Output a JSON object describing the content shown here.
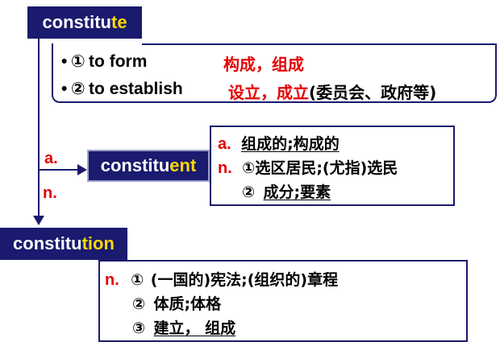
{
  "root_word": {
    "stem": "constitu",
    "suffix": "te"
  },
  "meanings": [
    {
      "num": "①",
      "en": "to form",
      "zh": "构成，组成",
      "zh_extra": ""
    },
    {
      "num": "②",
      "en": "to establish",
      "zh": "设立，成立",
      "zh_extra": "(委员会、政府等)"
    }
  ],
  "bullet": "•",
  "branch_labels": {
    "adjective": "a.",
    "noun": "n."
  },
  "derivative_1": {
    "stem": "constitu",
    "suffix": "ent",
    "def_a_label": "a.",
    "def_a": "组成的;构成的",
    "def_n_label": "n.",
    "def_n_1": "①选区居民;(尤指)选民",
    "def_n_2_num": "②",
    "def_n_2": "成分;要素"
  },
  "derivative_2": {
    "stem": "constitu",
    "suffix": "tion",
    "def_n_label": "n.",
    "def_1_num": "①",
    "def_1": "(一国的)宪法;(组织的)章程",
    "def_2_num": "②",
    "def_2": "体质;体格",
    "def_3_num": "③",
    "def_3": "建立， 组成"
  },
  "colors": {
    "navy": "#1a1a6e",
    "highlight": "#ffd800",
    "red": "#e60000"
  }
}
